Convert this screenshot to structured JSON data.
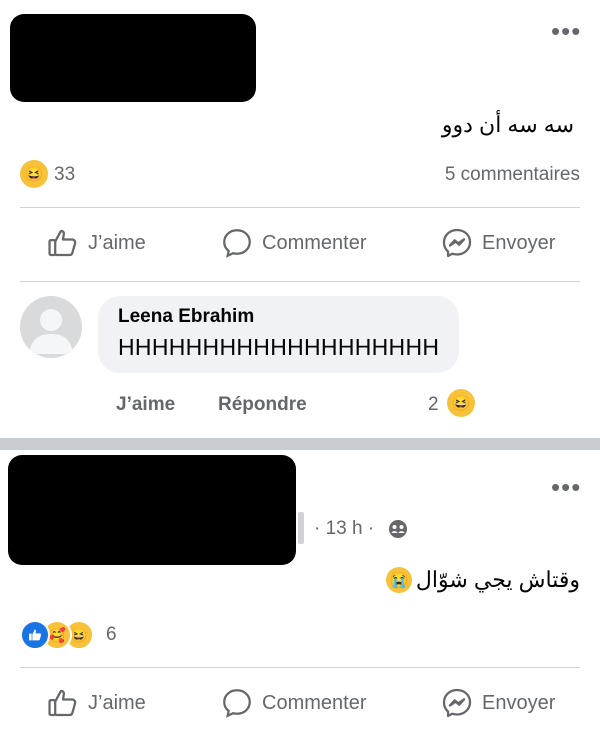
{
  "post1": {
    "text": "سه سه أن دوو",
    "reaction_count": "33",
    "comments_count": "5 commentaires"
  },
  "actions": {
    "like": "J’aime",
    "comment": "Commenter",
    "send": "Envoyer"
  },
  "comment": {
    "author": "Leena Ebrahim",
    "text": "HHHHHHHHHHHHHHHHHHH",
    "like": "J’aime",
    "reply": "Répondre",
    "reaction_count": "2"
  },
  "post2": {
    "time": "· 13 h ·",
    "text": "وقتاش يجي شوّال",
    "reaction_count": "6"
  },
  "icons": {
    "haha": "haha-emoji",
    "like": "like-emoji",
    "care": "care-emoji",
    "cry": "crying-face-emoji",
    "audience": "friends-audience-icon"
  }
}
